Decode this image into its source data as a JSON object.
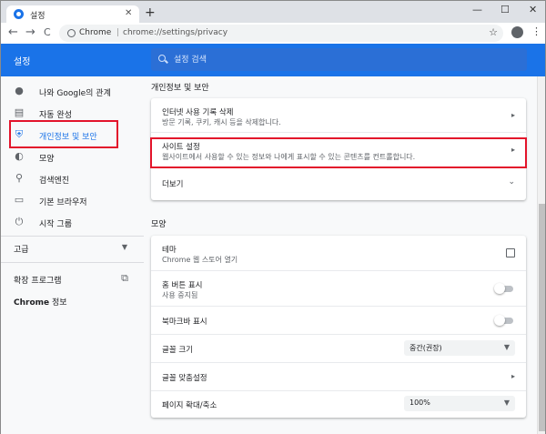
{
  "tab": {
    "title": "설정",
    "close": "✕",
    "new_tab": "+"
  },
  "window_controls": {
    "minimize": "—",
    "maximize": "☐",
    "close": "✕"
  },
  "toolbar": {
    "back": "←",
    "forward": "→",
    "reload": "C",
    "site": "Chrome",
    "separator": "|",
    "url": "chrome://settings/privacy",
    "star": "☆",
    "menu": "⋮"
  },
  "header": {
    "title": "설정",
    "search_placeholder": "설정 검색"
  },
  "sidebar": {
    "items": [
      {
        "label": "나와 Google의 관계",
        "icon": "person-icon"
      },
      {
        "label": "자동 완성",
        "icon": "clipboard-icon"
      },
      {
        "label": "개인정보 및 보안",
        "icon": "shield-icon"
      },
      {
        "label": "모양",
        "icon": "palette-icon"
      },
      {
        "label": "검색엔진",
        "icon": "search-icon"
      },
      {
        "label": "기본 브라우저",
        "icon": "browser-icon"
      },
      {
        "label": "시작 그룹",
        "icon": "power-icon"
      }
    ],
    "advanced": "고급",
    "extensions": "확장 프로그램",
    "about": {
      "bold": "Chrome",
      "rest": " 정보"
    }
  },
  "privacy": {
    "title": "개인정보 및 보안",
    "rows": [
      {
        "title": "인터넷 사용 기록 삭제",
        "sub": "방문 기록, 쿠키, 캐시 등을 삭제합니다."
      },
      {
        "title": "사이트 설정",
        "sub": "웹사이트에서 사용할 수 있는 정보와 나에게 표시할 수 있는 콘텐츠를 컨트롤합니다."
      }
    ],
    "more": "더보기"
  },
  "appearance": {
    "title": "모양",
    "theme": {
      "title": "테마",
      "sub": "Chrome 웹 스토어 열기"
    },
    "home_button": {
      "title": "홈 버튼 표시",
      "sub": "사용 중지됨",
      "enabled": false
    },
    "bookmarks_bar": {
      "title": "북마크바 표시",
      "enabled": false
    },
    "font_size": {
      "title": "글꼴 크기",
      "value": "중간(권장)"
    },
    "customize_fonts": {
      "title": "글꼴 맞춤설정"
    },
    "page_zoom": {
      "title": "페이지 확대/축소",
      "value": "100%"
    }
  },
  "colors": {
    "accent": "#1a73e8",
    "highlight": "#e3142b"
  }
}
